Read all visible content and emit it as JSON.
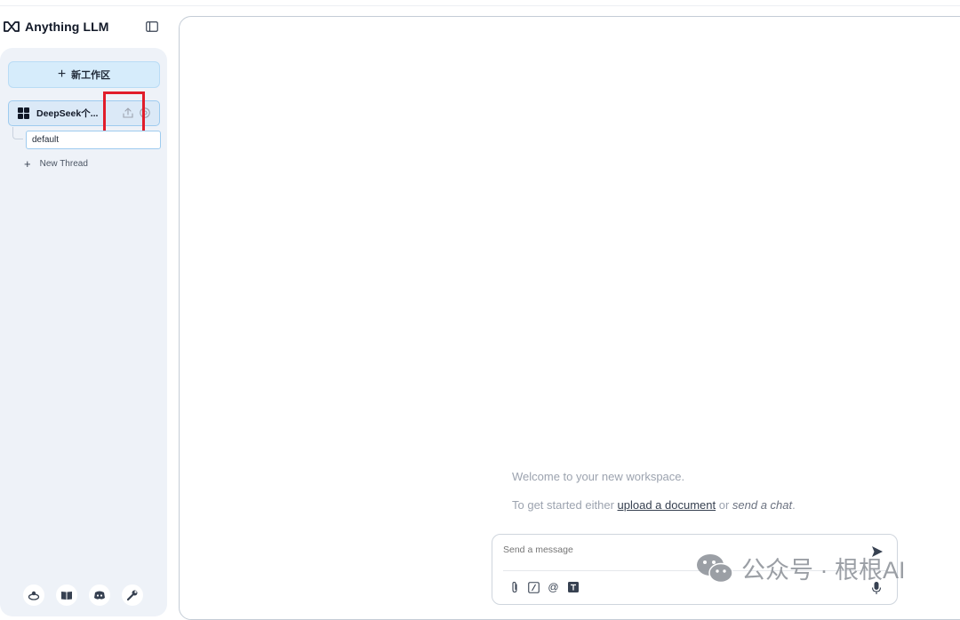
{
  "app": {
    "title": "Anything LLM"
  },
  "sidebar": {
    "new_workspace_label": "新工作区",
    "workspaces": [
      {
        "label": "DeepSeek个...",
        "threads": [
          {
            "label": "default"
          }
        ]
      }
    ],
    "new_thread_label": "New Thread",
    "footer_icons": [
      "community-hub-icon",
      "docs-book-icon",
      "discord-icon",
      "settings-wrench-icon"
    ]
  },
  "main": {
    "welcome_text": "Welcome to your new workspace.",
    "get_started_prefix": "To get started either ",
    "upload_link": "upload a document",
    "or_text": " or ",
    "send_chat_text": "send a chat",
    "period": "."
  },
  "composer": {
    "placeholder": "Send a message",
    "tools": [
      "attachment-icon",
      "slash-command-icon",
      "at-mention-icon",
      "text-size-icon"
    ]
  },
  "watermark": {
    "text": "公众号 · 根根AI"
  },
  "colors": {
    "accent": "#9ecbef",
    "highlight": "#e11d2a",
    "sidebar_bg": "#eef2f8"
  }
}
